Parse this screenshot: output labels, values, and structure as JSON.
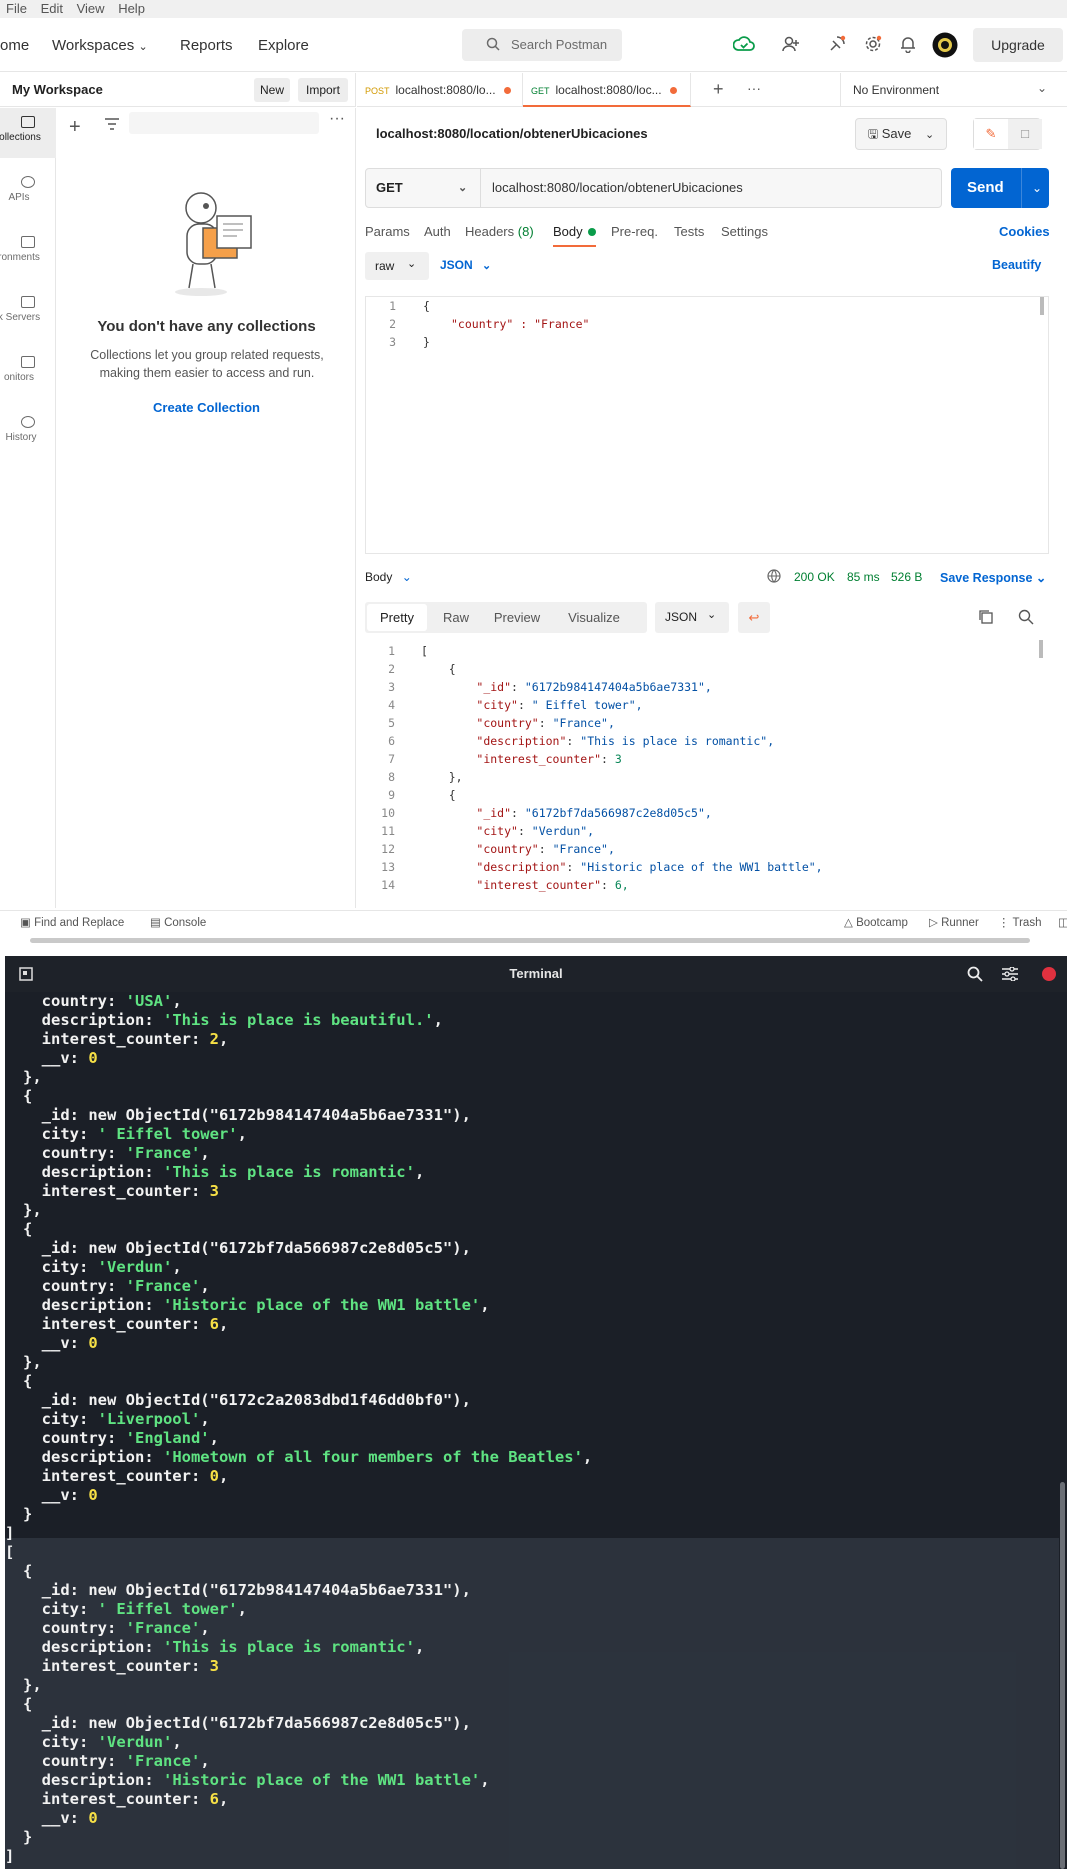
{
  "menu": [
    "File",
    "Edit",
    "View",
    "Help"
  ],
  "header": {
    "home_partial": "ome",
    "nav": [
      "Workspaces",
      "Reports",
      "Explore"
    ],
    "search_placeholder": "Search Postman",
    "upgrade": "Upgrade"
  },
  "workspace": {
    "title": "My Workspace",
    "new_label": "New",
    "import_label": "Import"
  },
  "iconbar": [
    "ollections",
    "APIs",
    "ronments",
    "k Servers",
    "onitors",
    "History"
  ],
  "collections": {
    "empty_title": "You don't have any collections",
    "empty_desc": "Collections let you group related requests, making them easier to access and run.",
    "create_label": "Create Collection"
  },
  "tabs": [
    {
      "method": "POST",
      "label": "localhost:8080/lo...",
      "color": "#d29900"
    },
    {
      "method": "GET",
      "label": "localhost:8080/loc...",
      "color": "#007f31"
    }
  ],
  "environment": "No Environment",
  "request": {
    "title": "localhost:8080/location/obtenerUbicaciones",
    "method": "GET",
    "url": "localhost:8080/location/obtenerUbicaciones",
    "send": "Send",
    "save": "Save",
    "tabs": [
      "Params",
      "Auth",
      "Headers",
      "(8)",
      "Body",
      "Pre-req.",
      "Tests",
      "Settings"
    ],
    "cookies": "Cookies",
    "body_mode": "raw",
    "body_format": "JSON",
    "beautify": "Beautify",
    "body_lines": [
      "{",
      "\"country\" : \"France\"",
      "}"
    ]
  },
  "response": {
    "label": "Body",
    "status": "200 OK",
    "time": "85 ms",
    "size": "526 B",
    "save_response": "Save Response",
    "view_tabs": [
      "Pretty",
      "Raw",
      "Preview",
      "Visualize"
    ],
    "format": "JSON",
    "lines": [
      "[",
      "    {",
      "        \"_id\": \"6172b984147404a5b6ae7331\",",
      "        \"city\": \" Eiffel tower\",",
      "        \"country\": \"France\",",
      "        \"description\": \"This is place is romantic\",",
      "        \"interest_counter\": 3",
      "    },",
      "    {",
      "        \"_id\": \"6172bf7da566987c2e8d05c5\",",
      "        \"city\": \"Verdun\",",
      "        \"country\": \"France\",",
      "        \"description\": \"Historic place of the WW1 battle\",",
      "        \"interest_counter\": 6,"
    ]
  },
  "footer": {
    "find_replace": "Find and Replace",
    "console": "Console",
    "bootcamp": "Bootcamp",
    "runner": "Runner",
    "trash": "Trash"
  },
  "terminal": {
    "title": "Terminal",
    "lines": [
      [
        [
          "  country: ",
          "k"
        ],
        [
          "'USA'",
          "s"
        ],
        [
          ",",
          "k"
        ]
      ],
      [
        [
          "  description: ",
          "k"
        ],
        [
          "'This is place is beautiful.'",
          "s"
        ],
        [
          ",",
          "k"
        ]
      ],
      [
        [
          "  interest_counter: ",
          "k"
        ],
        [
          "2",
          "n"
        ],
        [
          ",",
          "k"
        ]
      ],
      [
        [
          "  __v: ",
          "k"
        ],
        [
          "0",
          "n"
        ]
      ],
      [
        [
          "},",
          "k"
        ]
      ],
      [
        [
          "{",
          "k"
        ]
      ],
      [
        [
          "  _id: new ObjectId(\"6172b984147404a5b6ae7331\"),",
          "k"
        ]
      ],
      [
        [
          "  city: ",
          "k"
        ],
        [
          "' Eiffel tower'",
          "s"
        ],
        [
          ",",
          "k"
        ]
      ],
      [
        [
          "  country: ",
          "k"
        ],
        [
          "'France'",
          "s"
        ],
        [
          ",",
          "k"
        ]
      ],
      [
        [
          "  description: ",
          "k"
        ],
        [
          "'This is place is romantic'",
          "s"
        ],
        [
          ",",
          "k"
        ]
      ],
      [
        [
          "  interest_counter: ",
          "k"
        ],
        [
          "3",
          "n"
        ]
      ],
      [
        [
          "},",
          "k"
        ]
      ],
      [
        [
          "{",
          "k"
        ]
      ],
      [
        [
          "  _id: new ObjectId(\"6172bf7da566987c2e8d05c5\"),",
          "k"
        ]
      ],
      [
        [
          "  city: ",
          "k"
        ],
        [
          "'Verdun'",
          "s"
        ],
        [
          ",",
          "k"
        ]
      ],
      [
        [
          "  country: ",
          "k"
        ],
        [
          "'France'",
          "s"
        ],
        [
          ",",
          "k"
        ]
      ],
      [
        [
          "  description: ",
          "k"
        ],
        [
          "'Historic place of the WW1 battle'",
          "s"
        ],
        [
          ",",
          "k"
        ]
      ],
      [
        [
          "  interest_counter: ",
          "k"
        ],
        [
          "6",
          "n"
        ],
        [
          ",",
          "k"
        ]
      ],
      [
        [
          "  __v: ",
          "k"
        ],
        [
          "0",
          "n"
        ]
      ],
      [
        [
          "},",
          "k"
        ]
      ],
      [
        [
          "{",
          "k"
        ]
      ],
      [
        [
          "  _id: new ObjectId(\"6172c2a2083dbd1f46dd0bf0\"),",
          "k"
        ]
      ],
      [
        [
          "  city: ",
          "k"
        ],
        [
          "'Liverpool'",
          "s"
        ],
        [
          ",",
          "k"
        ]
      ],
      [
        [
          "  country: ",
          "k"
        ],
        [
          "'England'",
          "s"
        ],
        [
          ",",
          "k"
        ]
      ],
      [
        [
          "  description: ",
          "k"
        ],
        [
          "'Hometown of all four members of the Beatles'",
          "s"
        ],
        [
          ",",
          "k"
        ]
      ],
      [
        [
          "  interest_counter: ",
          "k"
        ],
        [
          "0",
          "n"
        ],
        [
          ",",
          "k"
        ]
      ],
      [
        [
          "  __v: ",
          "k"
        ],
        [
          "0",
          "n"
        ]
      ],
      [
        [
          "}",
          "k"
        ]
      ],
      [
        [
          "]",
          "k"
        ]
      ],
      [
        [
          "[",
          "k"
        ]
      ],
      [
        [
          "{",
          "k"
        ]
      ],
      [
        [
          "  _id: new ObjectId(\"6172b984147404a5b6ae7331\"),",
          "k"
        ]
      ],
      [
        [
          "  city: ",
          "k"
        ],
        [
          "' Eiffel tower'",
          "s"
        ],
        [
          ",",
          "k"
        ]
      ],
      [
        [
          "  country: ",
          "k"
        ],
        [
          "'France'",
          "s"
        ],
        [
          ",",
          "k"
        ]
      ],
      [
        [
          "  description: ",
          "k"
        ],
        [
          "'This is place is romantic'",
          "s"
        ],
        [
          ",",
          "k"
        ]
      ],
      [
        [
          "  interest_counter: ",
          "k"
        ],
        [
          "3",
          "n"
        ]
      ],
      [
        [
          "},",
          "k"
        ]
      ],
      [
        [
          "{",
          "k"
        ]
      ],
      [
        [
          "  _id: new ObjectId(\"6172bf7da566987c2e8d05c5\"),",
          "k"
        ]
      ],
      [
        [
          "  city: ",
          "k"
        ],
        [
          "'Verdun'",
          "s"
        ],
        [
          ",",
          "k"
        ]
      ],
      [
        [
          "  country: ",
          "k"
        ],
        [
          "'France'",
          "s"
        ],
        [
          ",",
          "k"
        ]
      ],
      [
        [
          "  description: ",
          "k"
        ],
        [
          "'Historic place of the WW1 battle'",
          "s"
        ],
        [
          ",",
          "k"
        ]
      ],
      [
        [
          "  interest_counter: ",
          "k"
        ],
        [
          "6",
          "n"
        ],
        [
          ",",
          "k"
        ]
      ],
      [
        [
          "  __v: ",
          "k"
        ],
        [
          "0",
          "n"
        ]
      ],
      [
        [
          "}",
          "k"
        ]
      ],
      [
        [
          "]",
          "k"
        ]
      ]
    ]
  },
  "colors": {
    "accent": "#0265d2",
    "postman_orange": "#f26b3a",
    "status_ok": "#007f31",
    "term_bg": "#1b1f27",
    "term_string": "#5fe382",
    "term_number": "#f7e046"
  }
}
